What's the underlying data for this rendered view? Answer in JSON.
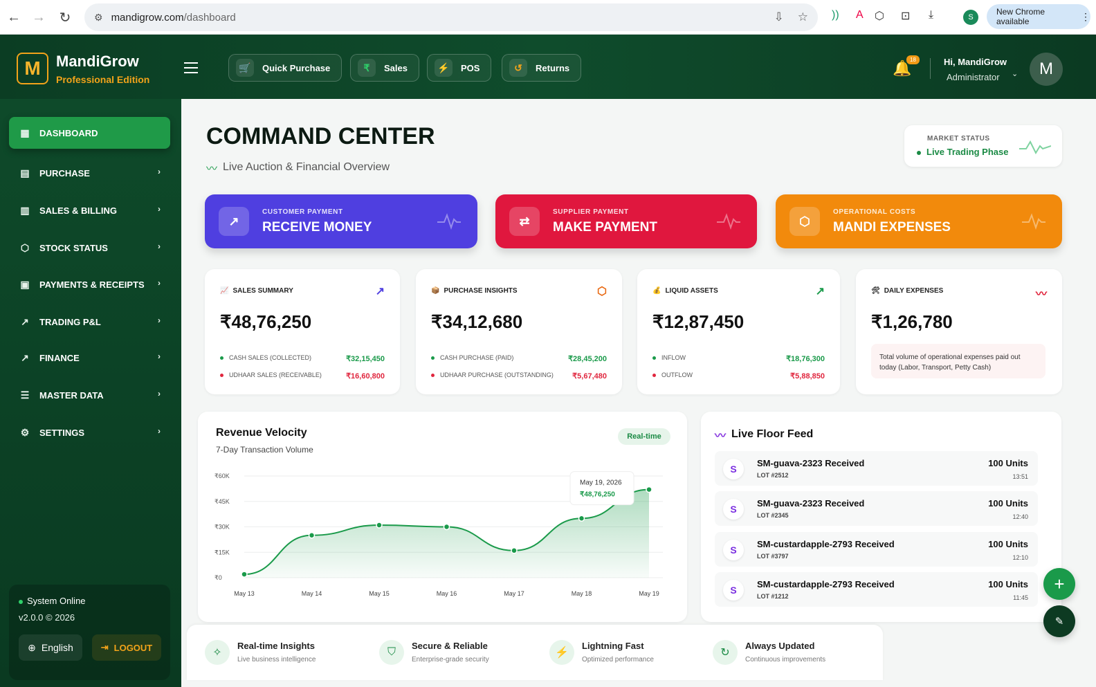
{
  "browser": {
    "url_domain": "mandigrow.com",
    "url_path": "/dashboard",
    "profile_initial": "S",
    "new_chrome_label": "New Chrome available"
  },
  "brand": {
    "logo_letter": "M",
    "name": "MandiGrow",
    "edition": "Professional Edition"
  },
  "quick_actions": [
    {
      "label": "Quick Purchase",
      "icon": "cart-icon",
      "icon_char": "🛒",
      "icon_color": "#ffffff"
    },
    {
      "label": "Sales",
      "icon": "rupee-icon",
      "icon_char": "₹",
      "icon_color": "#2fd06a"
    },
    {
      "label": "POS",
      "icon": "lightning-icon",
      "icon_char": "⚡",
      "icon_color": "#b98cff"
    },
    {
      "label": "Returns",
      "icon": "undo-icon",
      "icon_char": "↺",
      "icon_color": "#f2a31a"
    }
  ],
  "user": {
    "notifications": "18",
    "greeting": "Hi, MandiGrow",
    "role": "Administrator",
    "avatar_letter": "M"
  },
  "sidebar": {
    "items": [
      {
        "label": "DASHBOARD",
        "icon": "grid-icon",
        "icon_char": "▦",
        "active": true
      },
      {
        "label": "PURCHASE",
        "icon": "receipt-icon",
        "icon_char": "▤",
        "active": false
      },
      {
        "label": "SALES & BILLING",
        "icon": "invoice-icon",
        "icon_char": "▥",
        "active": false
      },
      {
        "label": "STOCK STATUS",
        "icon": "box-icon",
        "icon_char": "⬡",
        "active": false
      },
      {
        "label": "PAYMENTS & RECEIPTS",
        "icon": "wallet-icon",
        "icon_char": "▣",
        "active": false
      },
      {
        "label": "TRADING P&L",
        "icon": "trend-icon",
        "icon_char": "↗",
        "active": false
      },
      {
        "label": "FINANCE",
        "icon": "trend-up-icon",
        "icon_char": "↗",
        "active": false
      },
      {
        "label": "MASTER DATA",
        "icon": "database-icon",
        "icon_char": "☰",
        "active": false
      },
      {
        "label": "SETTINGS",
        "icon": "gear-icon",
        "icon_char": "⚙",
        "active": false
      }
    ],
    "system_status": "System Online",
    "version": "v2.0.0 © 2026",
    "language": "English",
    "logout": "LOGOUT"
  },
  "page": {
    "title": "COMMAND CENTER",
    "subtitle": "Live Auction & Financial Overview"
  },
  "market": {
    "label": "MARKET STATUS",
    "value": "Live Trading Phase"
  },
  "actions": [
    {
      "label": "CUSTOMER PAYMENT",
      "title": "RECEIVE MONEY",
      "icon": "arrow-up-right-icon",
      "icon_char": "↗",
      "color": "#4f3fe0"
    },
    {
      "label": "SUPPLIER PAYMENT",
      "title": "MAKE PAYMENT",
      "icon": "trend-arrows-icon",
      "icon_char": "⇄",
      "color": "#e0173e"
    },
    {
      "label": "OPERATIONAL COSTS",
      "title": "MANDI EXPENSES",
      "icon": "package-icon",
      "icon_char": "⬡",
      "color": "#f28a0c"
    }
  ],
  "stats": {
    "sales": {
      "title": "SALES SUMMARY",
      "emoji": "📈",
      "value": "₹48,76,250",
      "rows": [
        {
          "label": "CASH SALES (COLLECTED)",
          "value": "₹32,15,450",
          "type": "g"
        },
        {
          "label": "UDHAAR SALES (RECEIVABLE)",
          "value": "₹16,60,800",
          "type": "r"
        }
      ]
    },
    "purchase": {
      "title": "PURCHASE INSIGHTS",
      "emoji": "📦",
      "value": "₹34,12,680",
      "rows": [
        {
          "label": "CASH PURCHASE (PAID)",
          "value": "₹28,45,200",
          "type": "g"
        },
        {
          "label": "UDHAAR PURCHASE (OUTSTANDING)",
          "value": "₹5,67,480",
          "type": "r"
        }
      ]
    },
    "liquid": {
      "title": "LIQUID ASSETS",
      "emoji": "💰",
      "value": "₹12,87,450",
      "rows": [
        {
          "label": "INFLOW",
          "value": "₹18,76,300",
          "type": "g"
        },
        {
          "label": "OUTFLOW",
          "value": "₹5,88,850",
          "type": "r"
        }
      ]
    },
    "expenses": {
      "title": "DAILY EXPENSES",
      "emoji": "🛠",
      "value": "₹1,26,780",
      "note": "Total volume of operational expenses paid out today (Labor, Transport, Petty Cash)"
    }
  },
  "chart_card": {
    "title": "Revenue Velocity",
    "subtitle": "7-Day Transaction Volume",
    "badge": "Real-time",
    "tooltip_date": "May 19, 2026",
    "tooltip_value": "₹48,76,250"
  },
  "chart_data": {
    "type": "area",
    "title": "Revenue Velocity",
    "subtitle": "7-Day Transaction Volume",
    "x": [
      "May 13",
      "May 14",
      "May 15",
      "May 16",
      "May 17",
      "May 18",
      "May 19"
    ],
    "series": [
      {
        "values": [
          2000,
          25000,
          31000,
          30000,
          16000,
          35000,
          52000
        ]
      }
    ],
    "y_ticks": [
      "₹0",
      "₹15K",
      "₹30K",
      "₹45K",
      "₹60K"
    ],
    "ylim": [
      0,
      60000
    ],
    "grid": true,
    "color": "#1a9a4a"
  },
  "feed": {
    "title": "Live Floor Feed",
    "items": [
      {
        "initial": "S",
        "name": "SM-guava-2323 Received",
        "lot": "LOT #2512",
        "units": "100 Units",
        "time": "13:51"
      },
      {
        "initial": "S",
        "name": "SM-guava-2323 Received",
        "lot": "LOT #2345",
        "units": "100 Units",
        "time": "12:40"
      },
      {
        "initial": "S",
        "name": "SM-custardapple-2793 Received",
        "lot": "LOT #3797",
        "units": "100 Units",
        "time": "12:10"
      },
      {
        "initial": "S",
        "name": "SM-custardapple-2793 Received",
        "lot": "LOT #1212",
        "units": "100 Units",
        "time": "11:45"
      }
    ]
  },
  "features": [
    {
      "title": "Real-time Insights",
      "desc": "Live business intelligence",
      "icon": "sparkle-icon",
      "icon_char": "✧"
    },
    {
      "title": "Secure & Reliable",
      "desc": "Enterprise-grade security",
      "icon": "shield-icon",
      "icon_char": "⛉"
    },
    {
      "title": "Lightning Fast",
      "desc": "Optimized performance",
      "icon": "lightning-icon",
      "icon_char": "⚡"
    },
    {
      "title": "Always Updated",
      "desc": "Continuous improvements",
      "icon": "refresh-icon",
      "icon_char": "↻"
    }
  ]
}
